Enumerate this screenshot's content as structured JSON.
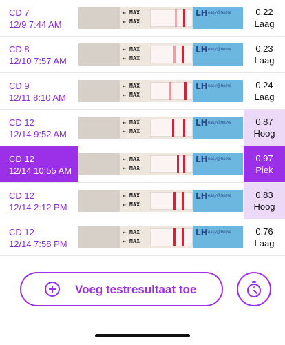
{
  "rows": [
    {
      "cycle_day": "CD 7",
      "datetime": "12/9 7:44 AM",
      "value": "0.22",
      "level": "Laag"
    },
    {
      "cycle_day": "CD 8",
      "datetime": "12/10 7:57 AM",
      "value": "0.23",
      "level": "Laag"
    },
    {
      "cycle_day": "CD 9",
      "datetime": "12/11 8:10 AM",
      "value": "0.24",
      "level": "Laag"
    },
    {
      "cycle_day": "CD 12",
      "datetime": "12/14 9:52 AM",
      "value": "0.87",
      "level": "Hoog"
    },
    {
      "cycle_day": "CD 12",
      "datetime": "12/14 10:55 AM",
      "value": "0.97",
      "level": "Piek"
    },
    {
      "cycle_day": "CD 12",
      "datetime": "12/14 2:12 PM",
      "value": "0.83",
      "level": "Hoog"
    },
    {
      "cycle_day": "CD 12",
      "datetime": "12/14 7:58 PM",
      "value": "0.76",
      "level": "Laag"
    }
  ],
  "strip_text": {
    "max_marker": "← MAX",
    "brand": "LH",
    "brand_sub": "easy@home"
  },
  "actions": {
    "add_result_label": "Voeg testresultaat toe"
  },
  "icons": {
    "add": "plus-circle-icon",
    "timer": "stopwatch-icon"
  },
  "colors": {
    "accent": "#9b30e8",
    "high_bg": "#ecd9f8",
    "test_line": "#c8283a"
  }
}
